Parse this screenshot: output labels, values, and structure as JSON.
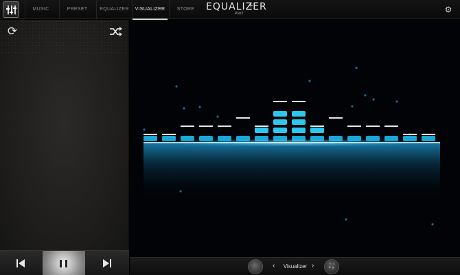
{
  "nav": {
    "tabs": [
      {
        "label": "MUSIC"
      },
      {
        "label": "PRESET"
      },
      {
        "label": "EQUALIZER"
      },
      {
        "label": "VISUALIZER"
      },
      {
        "label": "STORE"
      }
    ],
    "active_tab": "VISUALIZER",
    "brand": {
      "name": "EQUALIZER",
      "plus": "+",
      "sub": "PRO"
    },
    "settings_icon": "gear-icon"
  },
  "left_panel": {
    "top_left_icon": "refresh-icon",
    "top_right_icon": "shuffle-icon"
  },
  "transport": {
    "prev_icon": "skip-previous-icon",
    "play_pause_icon": "pause-icon",
    "next_icon": "skip-next-icon"
  },
  "visualizer": {
    "colors": {
      "bar": "#1aa8d8",
      "bar_bright": "#2fc7f0",
      "peak": "#e8e8e8",
      "glow": "#1e9ed8"
    },
    "levels": [
      1,
      1,
      1,
      1,
      1,
      1,
      2,
      4,
      4,
      2,
      1,
      1,
      1,
      1,
      1,
      1
    ],
    "peaks": [
      1,
      1,
      2,
      2,
      2,
      3,
      2,
      5,
      5,
      2,
      3,
      2,
      2,
      2,
      1,
      1
    ]
  },
  "bottom_bar": {
    "mode_label": "Visualizer",
    "prev_arrow": "‹",
    "next_arrow": "›",
    "left_knob_icon": "vinyl-icon",
    "right_knob_icon": "fullscreen-icon"
  }
}
